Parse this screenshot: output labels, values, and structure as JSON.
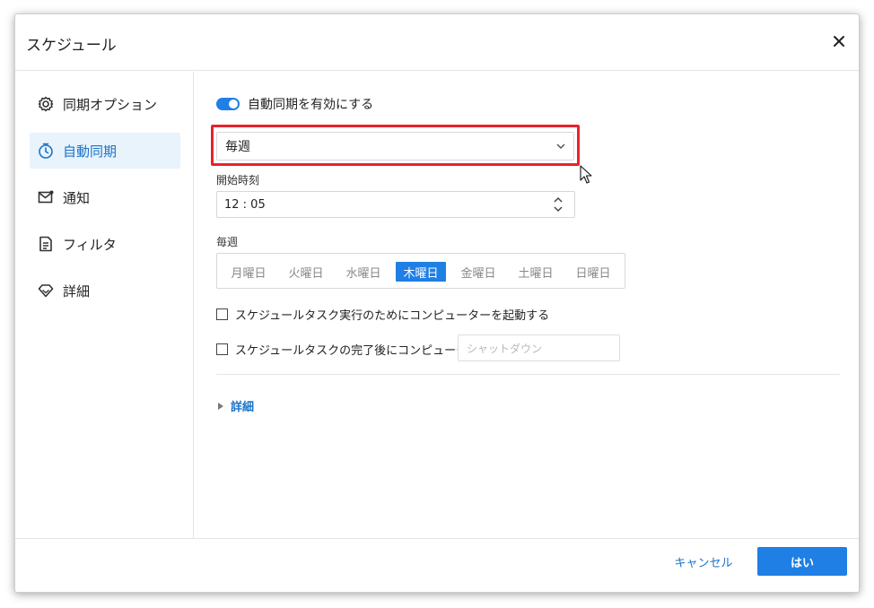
{
  "dialog": {
    "title": "スケジュール"
  },
  "sidebar": {
    "items": [
      {
        "label": "同期オプション",
        "icon": "gear-icon",
        "active": false
      },
      {
        "label": "自動同期",
        "icon": "timer-icon",
        "active": true
      },
      {
        "label": "通知",
        "icon": "mail-icon",
        "active": false
      },
      {
        "label": "フィルタ",
        "icon": "document-filter-icon",
        "active": false
      },
      {
        "label": "詳細",
        "icon": "diamond-icon",
        "active": false
      }
    ]
  },
  "main": {
    "toggle_label": "自動同期を有効にする",
    "toggle_on": true,
    "frequency": {
      "selected": "毎週"
    },
    "start_time": {
      "label": "開始時刻",
      "value": "12 : 05"
    },
    "weekly": {
      "label": "毎週",
      "days": [
        "月曜日",
        "火曜日",
        "水曜日",
        "木曜日",
        "金曜日",
        "土曜日",
        "日曜日"
      ],
      "selected_index": 3
    },
    "wake_option": {
      "label": "スケジュールタスク実行のためにコンピューターを起動する",
      "checked": false
    },
    "after_option": {
      "label": "スケジュールタスクの完了後にコンピューターを",
      "checked": false,
      "placeholder": "シャットダウン"
    },
    "details_label": "詳細"
  },
  "footer": {
    "cancel_label": "キャンセル",
    "ok_label": "はい"
  },
  "colors": {
    "accent": "#1f7fe5",
    "highlight": "#e8232b",
    "active_bg": "#e8f3fc"
  }
}
